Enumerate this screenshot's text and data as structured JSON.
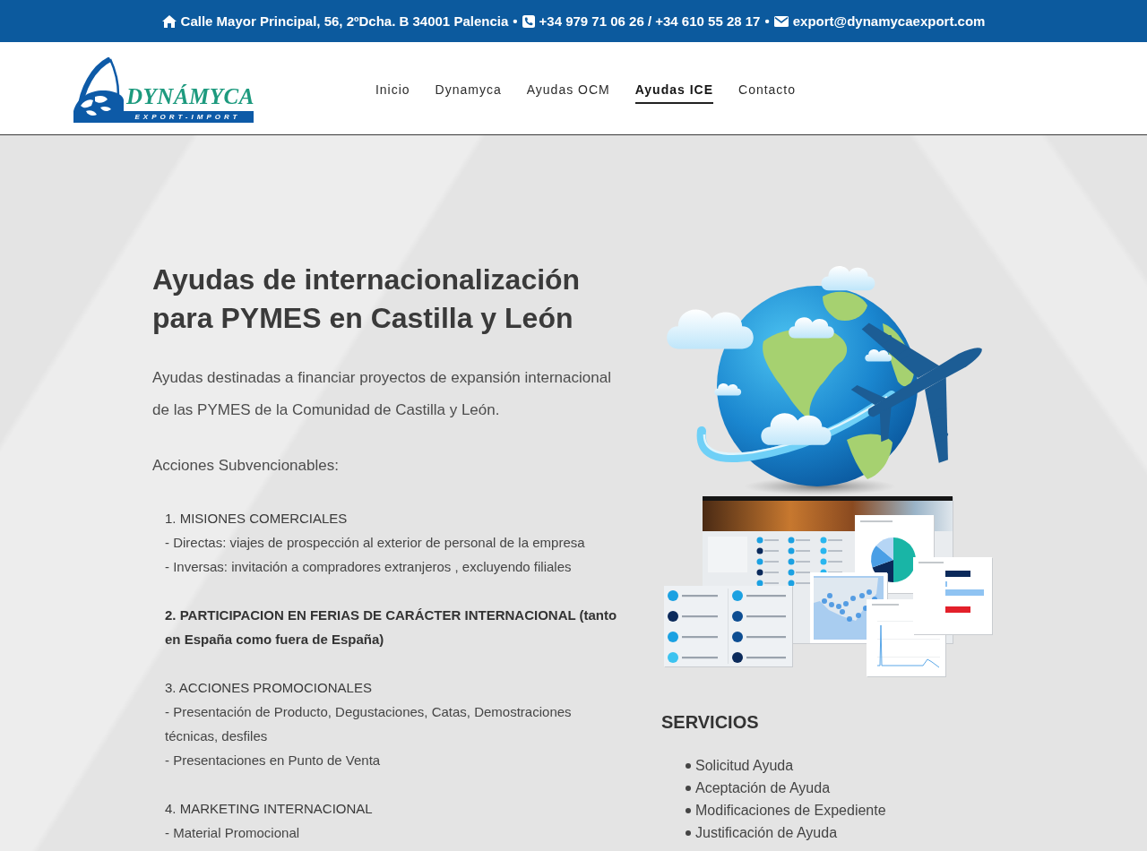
{
  "contact_bar": [
    {
      "kind": "address",
      "text": "Calle Mayor Principal, 56, 2ºDcha. B 34001 Palencia"
    },
    {
      "kind": "separator",
      "text": "•"
    },
    {
      "kind": "phone",
      "text": "+34 979 71 06 26 / +34 610 55 28 17"
    },
    {
      "kind": "separator",
      "text": "•"
    },
    {
      "kind": "email",
      "text": "export@dynamycaexport.com"
    }
  ],
  "logo": {
    "name": "DYNÁMYCA",
    "tagline": "EXPORT-IMPORT"
  },
  "nav": [
    {
      "label": "Inicio",
      "selected": false
    },
    {
      "label": "Dynamyca",
      "selected": false
    },
    {
      "label": "Ayudas OCM",
      "selected": false
    },
    {
      "label": "Ayudas ICE",
      "selected": true
    },
    {
      "label": "Contacto",
      "selected": false
    }
  ],
  "content": {
    "title": "Ayudas de internacionalización para PYMES en Castilla y León",
    "intro": "Ayudas destinadas a financiar proyectos de expansión internacional de las PYMES de la Comunidad de Castilla y León.",
    "actions_label": "Acciones Subvencionables:",
    "actions": [
      {
        "heading": "1. MISIONES COMERCIALES",
        "emphasized": false,
        "details": [
          "- Directas: viajes de prospección al exterior de personal de la empresa",
          "- Inversas: invitación a compradores extranjeros , excluyendo filiales"
        ]
      },
      {
        "heading": "2. PARTICIPACION EN FERIAS DE CARÁCTER INTERNACIONAL (tanto en España como fuera de España)",
        "emphasized": true
      },
      {
        "heading": "3. ACCIONES PROMOCIONALES",
        "emphasized": false,
        "details": [
          "- Presentación de Producto, Degustaciones, Catas, Demostraciones técnicas, desfiles",
          "- Presentaciones en Punto de Venta"
        ]
      },
      {
        "heading": "4. MARKETING INTERNACIONAL",
        "emphasized": false,
        "details": [
          "- Material Promocional"
        ]
      }
    ]
  },
  "services": {
    "heading": "SERVICIOS",
    "items": [
      "Solicitud Ayuda",
      "Aceptación de Ayuda",
      "Modificaciones de Expediente",
      "Justificación de Ayuda"
    ]
  }
}
